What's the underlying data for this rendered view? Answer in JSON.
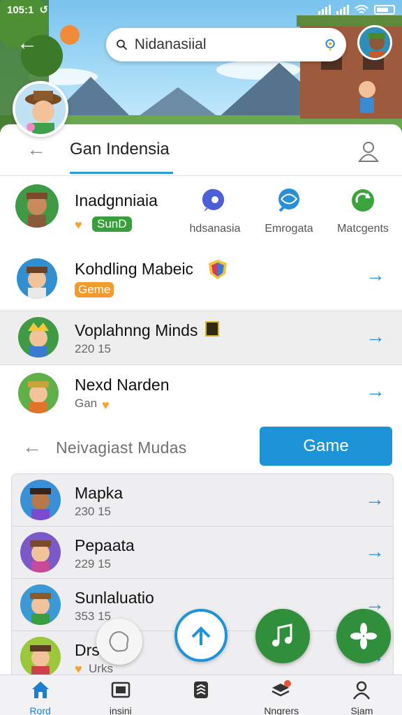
{
  "status_bar": {
    "time": "105:1",
    "sync_glyph": "↺"
  },
  "search": {
    "value": "Nidanasiial",
    "placeholder": "Nidanasiial"
  },
  "header": {
    "title": "Gan Indensia"
  },
  "featured": {
    "name": "Inadgnniaia",
    "badge": "SunD",
    "quick_actions": [
      {
        "label": "hdsanasia",
        "icon": "chat-bubble-icon",
        "color": "#4a5fd8"
      },
      {
        "label": "Emrogata",
        "icon": "globe-chat-icon",
        "color": "#2a8fd6"
      },
      {
        "label": "Matcgents",
        "icon": "refresh-leaf-icon",
        "color": "#3aa53a"
      }
    ]
  },
  "list1": [
    {
      "name": "Kohdling Mabeic",
      "badge": "Geme",
      "sub": ""
    },
    {
      "name": "Voplahnng Minds",
      "sub": "220 15"
    },
    {
      "name": "Nexd Narden",
      "sub": "Gan"
    }
  ],
  "section2": {
    "title": "Neivagiast  Mudas",
    "button": "Game"
  },
  "list2": [
    {
      "name": "Mapka",
      "sub": "230 15"
    },
    {
      "name": "Pepaata",
      "sub": "229 15"
    },
    {
      "name": "Sunlaluatio",
      "sub": "353 15"
    },
    {
      "name": "Drs",
      "sub": "Urks"
    }
  ],
  "bottom_nav": [
    {
      "label": "Rord",
      "icon": "home-icon",
      "active": true
    },
    {
      "label": "insini",
      "icon": "window-icon",
      "active": false
    },
    {
      "label": "",
      "icon": "stack-icon",
      "active": false
    },
    {
      "label": "Nngrers",
      "icon": "layers-badge-icon",
      "active": false
    },
    {
      "label": "Sjam",
      "icon": "person-icon",
      "active": false
    }
  ],
  "colors": {
    "accent": "#1e94d8",
    "green": "#3a9e3e",
    "orange": "#f39a2c"
  }
}
